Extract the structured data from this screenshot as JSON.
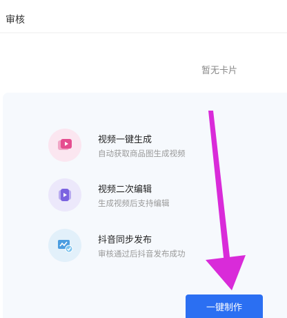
{
  "header": {
    "title": "审核"
  },
  "cards": {
    "empty_text": "暂无卡片"
  },
  "features": [
    {
      "title": "视频一键生成",
      "desc": "自动获取商品图生成视频",
      "icon": "video-generate-icon"
    },
    {
      "title": "视频二次编辑",
      "desc": "生成视频后支持编辑",
      "icon": "video-edit-icon"
    },
    {
      "title": "抖音同步发布",
      "desc": "审核通过后抖音发布成功",
      "icon": "douyin-publish-icon"
    }
  ],
  "cta": {
    "label": "一键制作"
  },
  "colors": {
    "primary": "#2b6ff2",
    "annotation_arrow": "#d92bd9",
    "panel_bg": "#f6f9fd"
  }
}
